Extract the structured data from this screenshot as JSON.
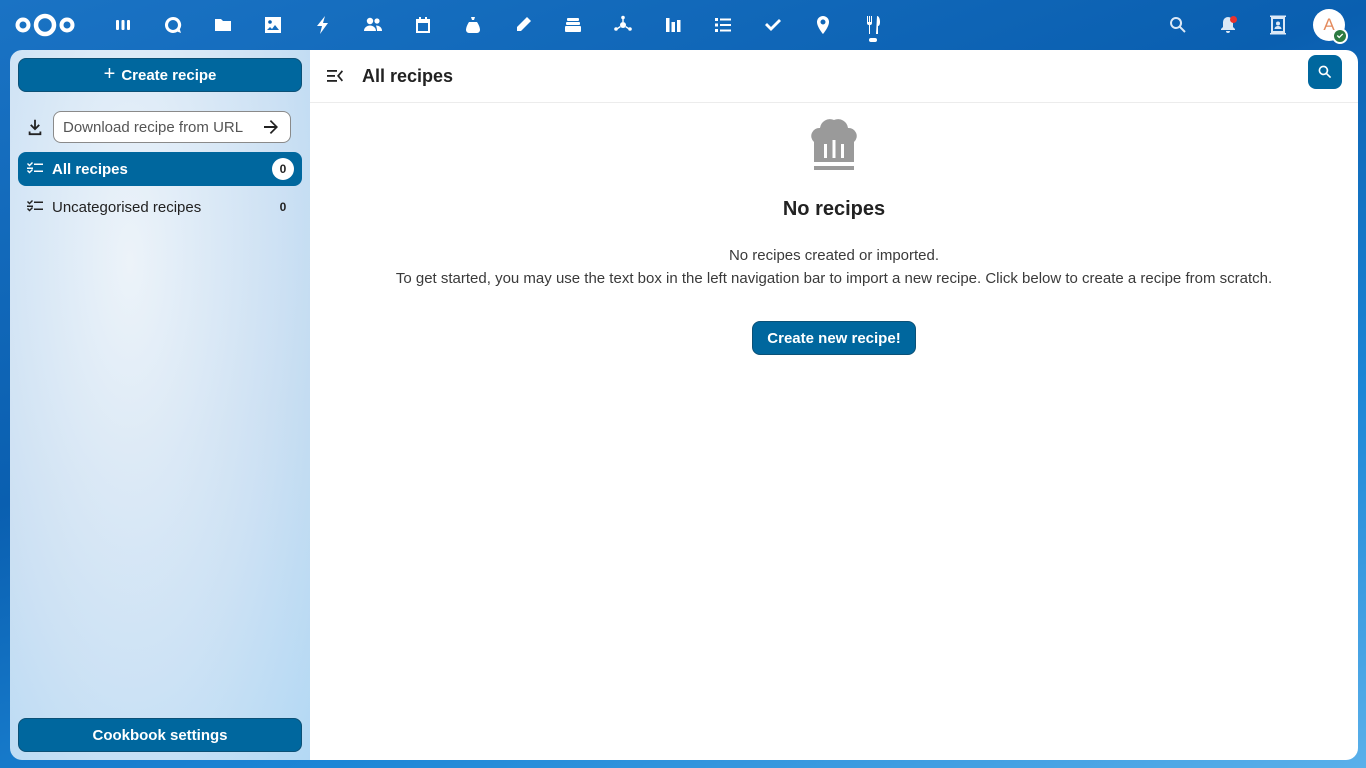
{
  "header": {
    "apps": [
      {
        "name": "dashboard",
        "icon": "dashboard-icon"
      },
      {
        "name": "talk",
        "icon": "talk-icon"
      },
      {
        "name": "files",
        "icon": "folder-icon"
      },
      {
        "name": "photos",
        "icon": "image-icon"
      },
      {
        "name": "activity",
        "icon": "lightning-icon"
      },
      {
        "name": "contacts",
        "icon": "contacts-icon"
      },
      {
        "name": "calendar",
        "icon": "calendar-icon"
      },
      {
        "name": "cospend",
        "icon": "money-bag-icon"
      },
      {
        "name": "notes",
        "icon": "pencil-icon"
      },
      {
        "name": "deck",
        "icon": "deck-icon"
      },
      {
        "name": "circles",
        "icon": "circles-icon"
      },
      {
        "name": "analytics",
        "icon": "bar-chart-icon"
      },
      {
        "name": "tasks",
        "icon": "list-icon"
      },
      {
        "name": "checklist",
        "icon": "check-icon"
      },
      {
        "name": "maps",
        "icon": "map-pin-icon"
      },
      {
        "name": "cookbook",
        "icon": "cutlery-icon",
        "active": true
      }
    ],
    "avatar_letter": "A"
  },
  "sidebar": {
    "create_recipe_label": "Create recipe",
    "download_placeholder": "Download recipe from URL",
    "nav": [
      {
        "label": "All recipes",
        "count": "0",
        "active": true
      },
      {
        "label": "Uncategorised recipes",
        "count": "0"
      }
    ],
    "settings_label": "Cookbook settings"
  },
  "main": {
    "title": "All recipes",
    "empty_title": "No recipes",
    "empty_line1": "No recipes created or imported.",
    "empty_line2": "To get started, you may use the text box in the left navigation bar to import a new recipe. Click below to create a recipe from scratch.",
    "create_new_label": "Create new recipe!"
  },
  "colors": {
    "primary": "#00679e",
    "header_bg": "#0a5fb0",
    "notification_dot": "#e9322d",
    "status_online": "#2d7b41"
  }
}
